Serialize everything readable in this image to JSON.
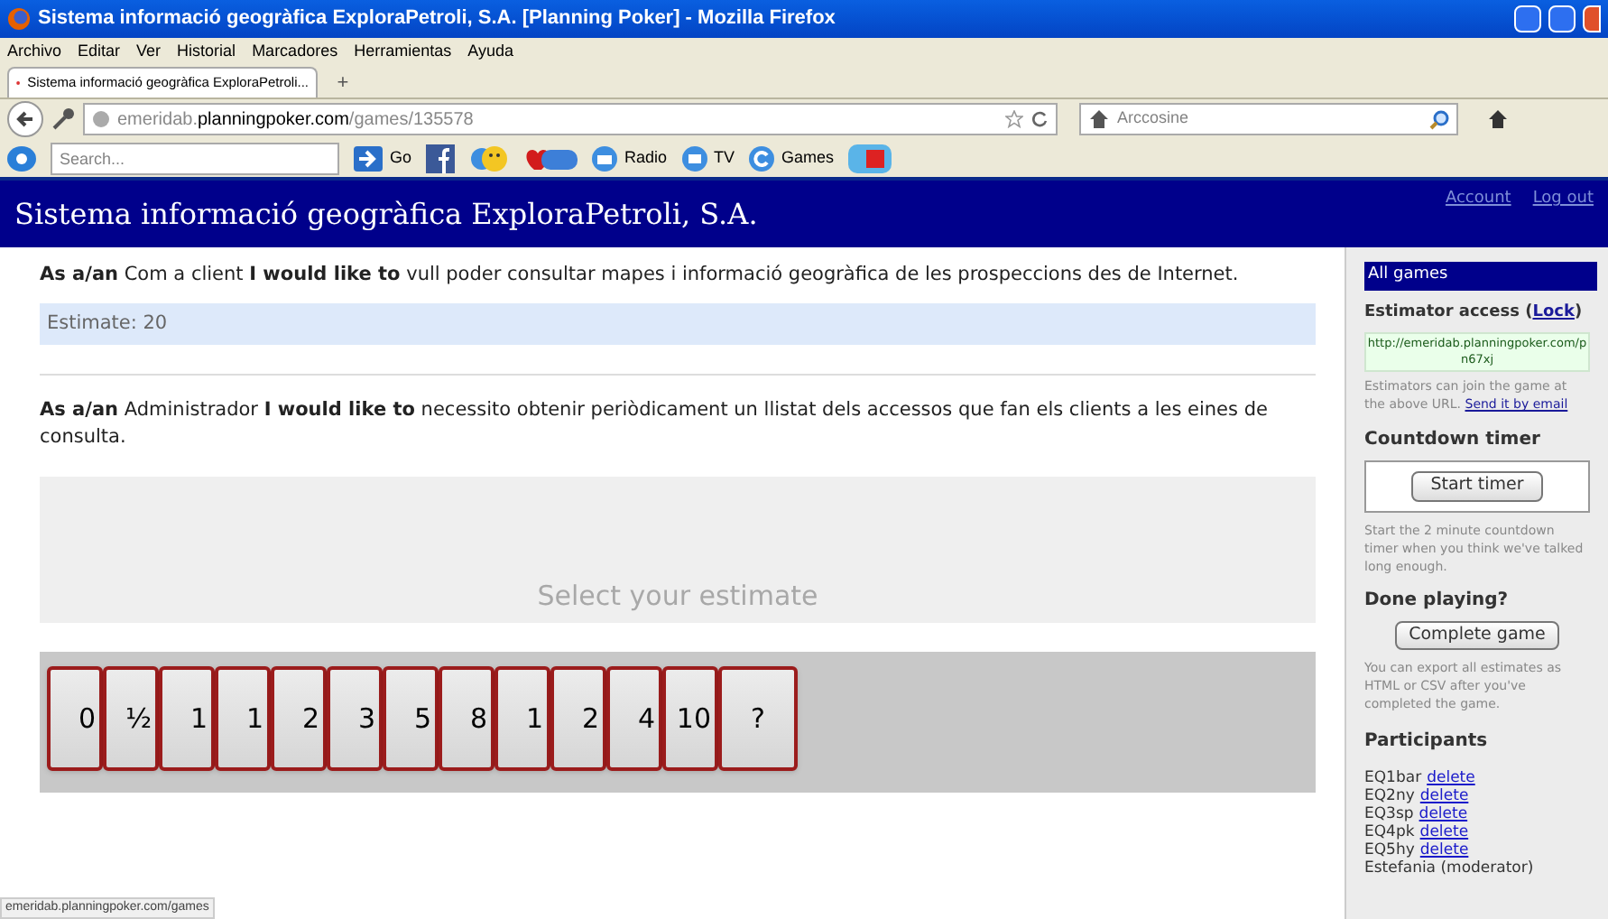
{
  "window": {
    "title": "Sistema informació geogràfica ExploraPetroli, S.A. [Planning Poker] - Mozilla Firefox"
  },
  "menu": [
    "Archivo",
    "Editar",
    "Ver",
    "Historial",
    "Marcadores",
    "Herramientas",
    "Ayuda"
  ],
  "tabs": [
    {
      "label": "Sistema informació geogràfica ExploraPetroli...",
      "selected": true
    }
  ],
  "new_tab": "+",
  "address": {
    "host_prefix": "emeridab.",
    "host": "planningpoker.com",
    "path": "/games/135578"
  },
  "web_search": {
    "placeholder": "Arccosine"
  },
  "bookmarks": {
    "search_placeholder": "Search...",
    "items": [
      {
        "kind": "go",
        "label": "Go"
      },
      {
        "kind": "facebook"
      },
      {
        "kind": "smiley"
      },
      {
        "kind": "vday"
      },
      {
        "kind": "radio",
        "label": "Radio"
      },
      {
        "kind": "tv",
        "label": "TV"
      },
      {
        "kind": "games",
        "label": "Games"
      },
      {
        "kind": "video"
      }
    ]
  },
  "header": {
    "title": "Sistema informació geogràfica ExploraPetroli, S.A.",
    "links": [
      "Account",
      "Log out"
    ]
  },
  "stories": [
    {
      "text": "**As a/an** Com a client **I would like to** vull poder consultar mapes i informació geogràfica de les prospeccions des de Internet.",
      "estimate": "Estimate: 20"
    },
    {
      "text": "**As a/an** Administrador **I would like to** necessito obtenir periòdicament un llistat dels accessos que fan els clients a les eines de consulta.",
      "prompt": "Select your estimate"
    }
  ],
  "cards": [
    "0",
    "½",
    "1",
    "1",
    "2",
    "3",
    "5",
    "8",
    "1",
    "2",
    "4",
    "10",
    "?"
  ],
  "sidebar": {
    "all_games": "All games",
    "access_title": "Estimator access (",
    "lock": "Lock",
    "access_close": ")",
    "url": "http://emeridab.planningpoker.com/pn67xj",
    "access_note": "Estimators can join the game at the above URL.",
    "email_link": "Send it by email",
    "timer_title": "Countdown timer",
    "timer_button": "Start timer",
    "timer_note": "Start the 2 minute countdown timer when you think we've talked long enough.",
    "done_title": "Done playing?",
    "done_button": "Complete game",
    "done_note": "You can export all estimates as HTML or CSV after you've completed the game.",
    "participants_title": "Participants",
    "participants": [
      {
        "name": "EQ1bar",
        "action": "delete"
      },
      {
        "name": "EQ2ny",
        "action": "delete"
      },
      {
        "name": "EQ3sp",
        "action": "delete"
      },
      {
        "name": "EQ4pk",
        "action": "delete"
      },
      {
        "name": "EQ5hy",
        "action": "delete"
      },
      {
        "name": "Estefania (moderator)"
      }
    ]
  },
  "status_bar": "emeridab.planningpoker.com/games"
}
